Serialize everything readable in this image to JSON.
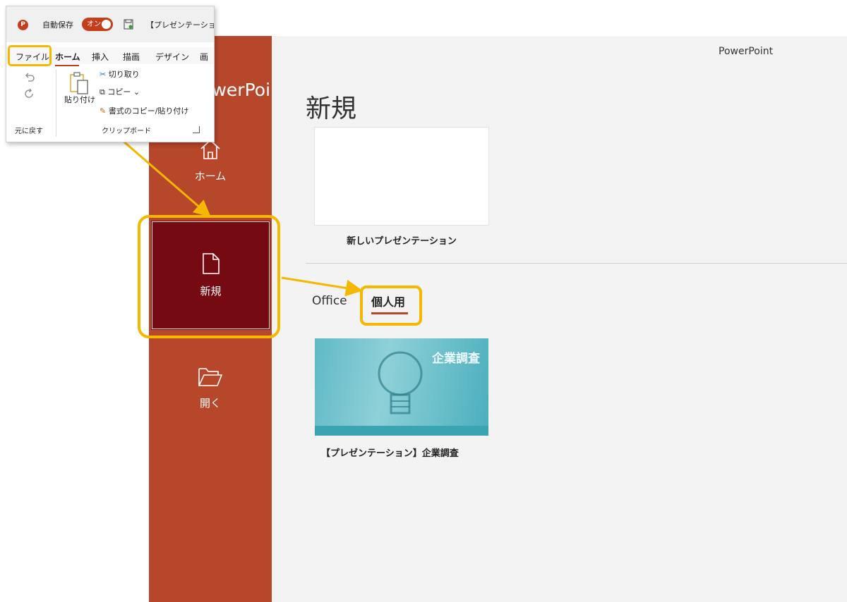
{
  "window": {
    "app_name": "PowerPoint"
  },
  "sidebar": {
    "title": "PowerPoint",
    "items": [
      {
        "label": "ホーム",
        "icon": "home-icon"
      },
      {
        "label": "新規",
        "icon": "new-document-icon"
      },
      {
        "label": "開く",
        "icon": "open-folder-icon"
      }
    ]
  },
  "main": {
    "title": "新規",
    "blank": {
      "label": "新しいプレゼンテーション"
    },
    "tabs": [
      {
        "label": "Office"
      },
      {
        "label": "個人用"
      }
    ],
    "template": {
      "thumb_title": "企業調査",
      "label": "【プレゼンテーション】企業調査"
    }
  },
  "ribbon": {
    "app_icon_text": "P",
    "autosave_label": "自動保存",
    "toggle_label": "オン",
    "document_name": "【プレゼンテーション",
    "tabs": [
      "ファイル",
      "ホーム",
      "挿入",
      "描画",
      "デザイン",
      "画"
    ],
    "undo_group_label": "元に戻す",
    "paste_label": "貼り付け",
    "cut_label": "切り取り",
    "copy_label": "コピー",
    "format_painter_label": "書式のコピー/貼り付け",
    "clipboard_group_label": "クリップボード"
  },
  "colors": {
    "sidebar": "#b7472a",
    "selected": "#750a12",
    "highlight": "#f5b800",
    "main_bg": "#f3f3f3"
  }
}
